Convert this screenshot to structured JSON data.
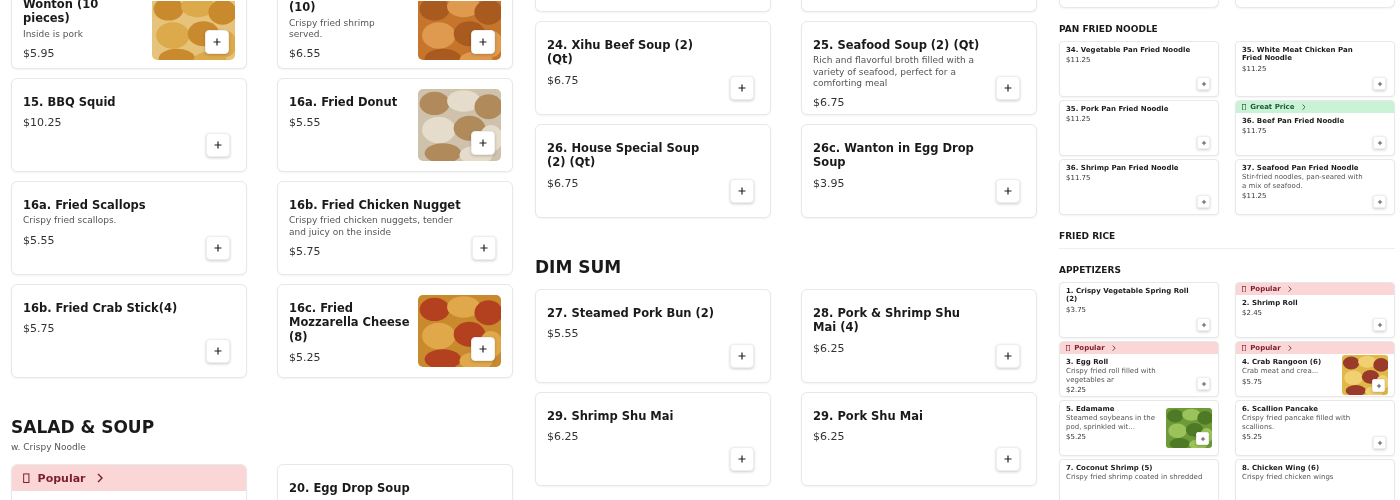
{
  "columns": [
    {
      "kind": "large",
      "sections": [
        {
          "kind": "normal",
          "items": [
            {
              "kind": "cut",
              "name": "Wonton (10 pieces)",
              "description": "Inside is pork",
              "price": "$5.95"
            },
            {
              "kind": "cut",
              "name": "(10)",
              "description": "Crispy fried shrimp served.",
              "price": "$6.55"
            },
            {
              "kind": "full",
              "name": "15. BBQ Squid",
              "price": "$10.25"
            },
            {
              "kind": "full",
              "name": "16a. Fried Donut",
              "price": "$5.55"
            },
            {
              "kind": "full",
              "name": "16a. Fried Scallops",
              "description": "Crispy fried scallops.",
              "price": "$5.55"
            },
            {
              "kind": "full",
              "name": "16b. Fried Chicken Nugget",
              "description": "Crispy fried chicken nuggets, tender and juicy on the inside",
              "price": "$5.75"
            },
            {
              "kind": "full",
              "name": "16b. Fried Crab Stick(4)",
              "price": "$5.75"
            },
            {
              "kind": "full",
              "name": "16c. Fried Mozzarella Cheese (8)",
              "price": "$5.25"
            }
          ]
        },
        {
          "kind": "normal",
          "heading": "SALAD & SOUP",
          "subtitle": "w. Crispy Noodle",
          "items": [
            {
              "kind": "full",
              "badge": {
                "kind": "popular",
                "label": "Popular"
              }
            },
            {
              "kind": "full",
              "name": "20. Egg Drop Soup"
            }
          ]
        }
      ]
    },
    {
      "kind": "large",
      "sections": [
        {
          "kind": "normal",
          "items": [
            {
              "kind": "hidden"
            },
            {
              "kind": "hidden"
            },
            {
              "kind": "full",
              "name": "24. Xihu Beef Soup (2) (Qt)",
              "price": "$6.75"
            },
            {
              "kind": "full",
              "name": "25. Seafood Soup (2) (Qt)",
              "description": "Rich and flavorful broth filled with a variety of seafood, perfect for a comforting meal",
              "price": "$6.75"
            },
            {
              "kind": "full",
              "name": "26. House Special Soup (2) (Qt)",
              "price": "$6.75"
            },
            {
              "kind": "full",
              "name": "26c. Wanton in Egg Drop Soup",
              "price": "$3.95"
            }
          ]
        },
        {
          "kind": "normal",
          "heading": "DIM SUM",
          "items": [
            {
              "kind": "full",
              "name": "27. Steamed Pork Bun (2)",
              "price": "$5.55"
            },
            {
              "kind": "full",
              "name": "28. Pork & Shrimp Shu Mai (4)",
              "price": "$6.25"
            },
            {
              "kind": "full",
              "name": "29. Shrimp Shu Mai",
              "price": "$6.25"
            },
            {
              "kind": "full",
              "name": "29. Pork Shu Mai",
              "price": "$6.25"
            }
          ]
        }
      ]
    },
    {
      "kind": "small",
      "sections": [
        {
          "kind": "normal",
          "items": [
            {
              "kind": "hidden"
            },
            {
              "kind": "hidden"
            }
          ]
        },
        {
          "kind": "normal",
          "heading": "PAN FRIED NOODLE",
          "items": [
            {
              "kind": "full",
              "name": "34. Vegetable Pan Fried Noodle",
              "price": "$11.25"
            },
            {
              "kind": "full",
              "name": "35. White Meat Chicken Pan Fried Noodle",
              "price": "$11.25"
            },
            {
              "kind": "full",
              "name": "35. Pork Pan Fried Noodle",
              "price": "$11.25"
            },
            {
              "kind": "full",
              "badge": {
                "kind": "great_price",
                "label": "Great Price"
              },
              "name": "36. Beef Pan Fried Noodle",
              "price": "$11.75"
            },
            {
              "kind": "full",
              "name": "36. Shrimp Pan Fried Noodle",
              "price": "$11.75"
            },
            {
              "kind": "full",
              "name": "37. Seafood Pan Fried Noodle",
              "description": "Stir-fried noodles, pan-seared with a mix of seafood.",
              "price": "$11.25"
            }
          ]
        },
        {
          "kind": "clipped",
          "heading": "FRIED RICE"
        },
        {
          "kind": "normal",
          "heading": "APPETIZERS",
          "items": [
            {
              "kind": "full",
              "name": "1. Crispy Vegetable Spring Roll (2)",
              "price": "$3.75"
            },
            {
              "kind": "full",
              "badge": {
                "kind": "popular",
                "label": "Popular"
              },
              "name": "2. Shrimp Roll",
              "price": "$2.45"
            },
            {
              "kind": "full",
              "badge": {
                "kind": "popular",
                "label": "Popular"
              },
              "name": "3. Egg Roll",
              "description": "Crispy fried roll filled with vegetables ar",
              "price": "$2.25"
            },
            {
              "kind": "full",
              "badge": {
                "kind": "popular",
                "label": "Popular"
              },
              "name": "4. Crab Rangoon (6)",
              "description": "Crab meat and crea...",
              "price": "$5.75"
            },
            {
              "kind": "full",
              "name": "5. Edamame",
              "description": "Steamed soybeans in the pod, sprinkled wit...",
              "price": "$5.25"
            },
            {
              "kind": "full",
              "name": "6. Scallion Pancake",
              "description": "Crispy fried pancake filled with scallions.",
              "price": "$5.25"
            },
            {
              "kind": "full",
              "name": "7. Coconut Shrimp (5)",
              "description": "Crispy fried shrimp coated in shredded"
            },
            {
              "kind": "full",
              "name": "8. Chicken Wing (6)",
              "description": "Crispy fried chicken wings"
            }
          ]
        }
      ]
    }
  ]
}
